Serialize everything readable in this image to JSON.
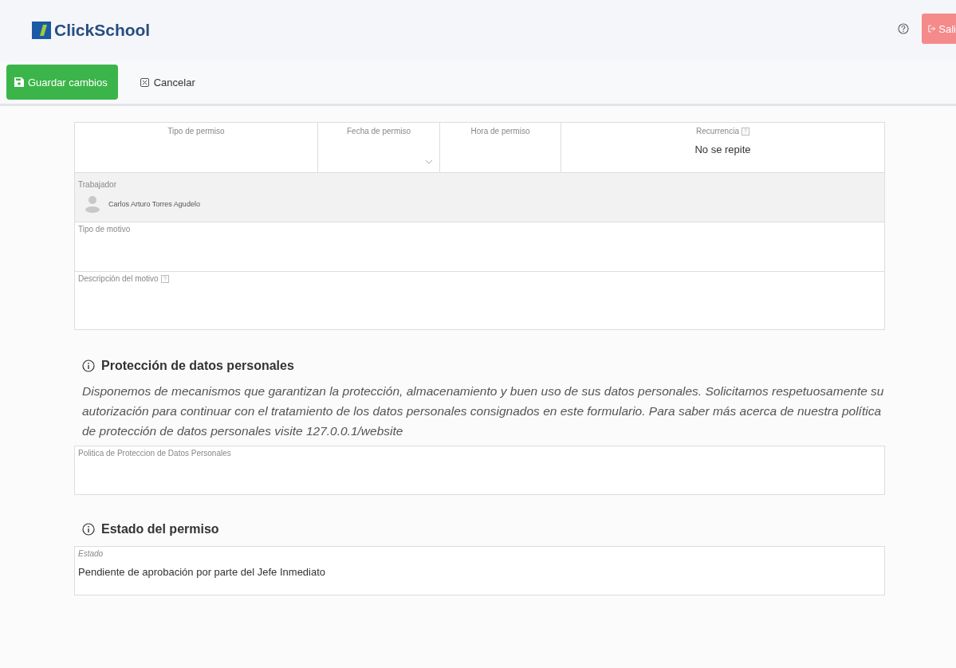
{
  "header": {
    "logo": "ClickSchool",
    "logout_button": "Sali"
  },
  "toolbar": {
    "save_button": "Guardar cambios",
    "cancel_button": "Cancelar"
  },
  "form": {
    "top_fields": [
      {
        "label": "Tipo de permiso",
        "kind": "text",
        "help": false
      },
      {
        "label": "Fecha de permiso",
        "kind": "select",
        "help": false
      },
      {
        "label": "Hora de permiso",
        "kind": "text",
        "help": false
      },
      {
        "label": "Recurrencia",
        "value": "No se repite",
        "kind": "text",
        "help": true
      }
    ],
    "worker": {
      "label": "Trabajador",
      "name": "Carlos Arturo Torres Agudelo"
    },
    "reason_type": {
      "label": "Tipo de motivo",
      "help": false
    },
    "reason_description": {
      "label": "Descripción del motivo",
      "help": true
    }
  },
  "privacy": {
    "title": "Protección de datos personales",
    "text": "Disponemos de mecanismos que garantizan la protección, almacenamiento y buen uso de sus datos personales. Solicitamos respetuosamente su autorización para continuar con el tratamiento de los datos personales consignados en este formulario. Para saber más acerca de nuestra política de protección de datos personales visite 127.0.0.1/website",
    "policy_field": {
      "label": "Politica de Proteccion de Datos Personales"
    }
  },
  "status": {
    "title": "Estado del permiso",
    "field": {
      "label": "Estado",
      "value": "Pendiente de aprobación por parte del Jefe Inmediato"
    }
  }
}
